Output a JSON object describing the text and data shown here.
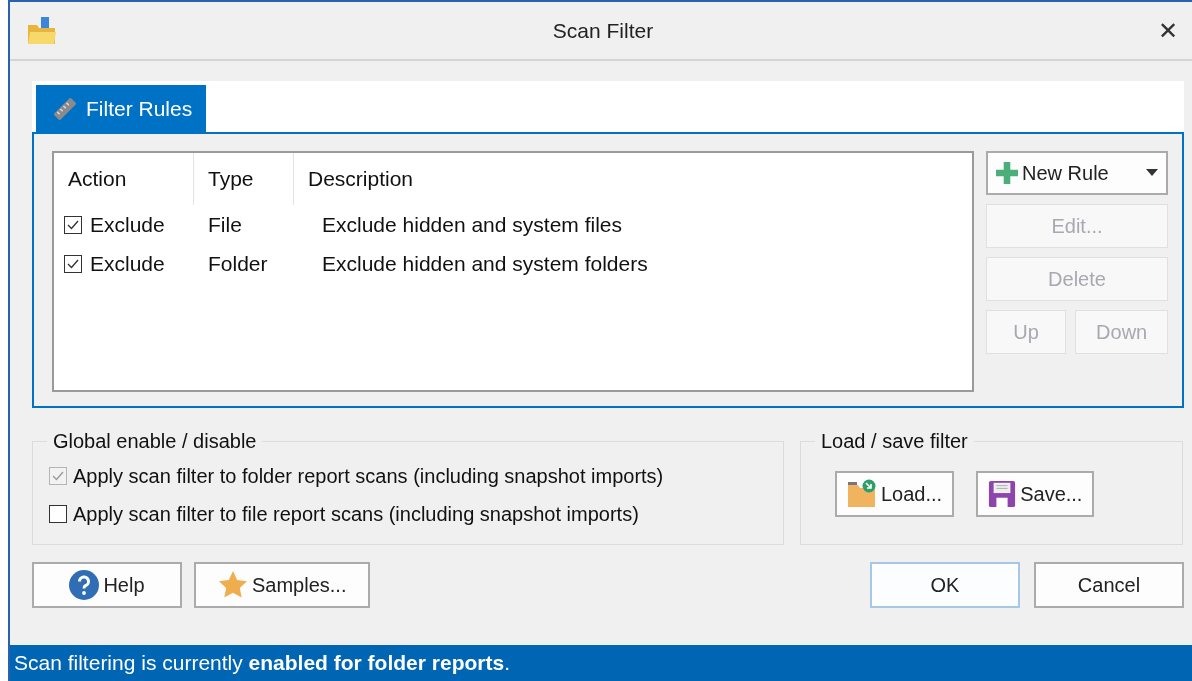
{
  "window": {
    "title": "Scan Filter",
    "close": "✕"
  },
  "tabs": [
    {
      "label": "Filter Rules",
      "selected": true
    }
  ],
  "rules_table": {
    "columns": [
      "Action",
      "Type",
      "Description"
    ],
    "rows": [
      {
        "checked": true,
        "action": "Exclude",
        "type": "File",
        "description": "Exclude hidden and system files"
      },
      {
        "checked": true,
        "action": "Exclude",
        "type": "Folder",
        "description": "Exclude hidden and system folders"
      }
    ]
  },
  "rule_buttons": [
    {
      "kind": "new",
      "label": "New Rule",
      "disabled": false
    },
    {
      "kind": "edit",
      "label": "Edit...",
      "disabled": true
    },
    {
      "kind": "delete",
      "label": "Delete",
      "disabled": true
    },
    {
      "kind": "up",
      "label": "Up",
      "disabled": true
    },
    {
      "kind": "down",
      "label": "Down",
      "disabled": true
    }
  ],
  "global_group": {
    "title": "Global enable / disable",
    "options": [
      {
        "label": "Apply scan filter to folder report scans (including snapshot imports)",
        "checked": true,
        "disabled": true
      },
      {
        "label": "Apply scan filter to file report scans (including snapshot imports)",
        "checked": false,
        "disabled": false
      }
    ]
  },
  "load_save_group": {
    "title": "Load / save filter",
    "buttons": [
      {
        "kind": "load",
        "label": "Load..."
      },
      {
        "kind": "save",
        "label": "Save..."
      }
    ]
  },
  "footer_buttons": [
    {
      "kind": "help",
      "label": "Help"
    },
    {
      "kind": "samples",
      "label": "Samples..."
    },
    {
      "kind": "ok",
      "label": "OK"
    },
    {
      "kind": "cancel",
      "label": "Cancel"
    }
  ],
  "status_bar": "Scan filtering is currently **enabled for folder reports**."
}
